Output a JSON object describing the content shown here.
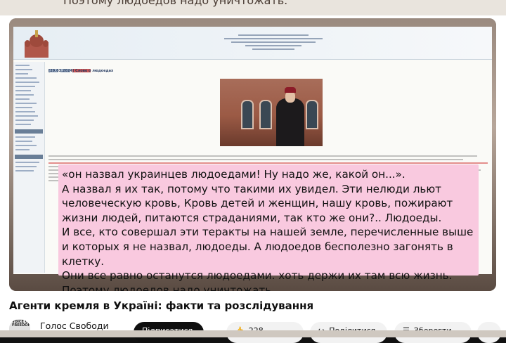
{
  "top_overlay": {
    "text": "Поэтому людоедов надо уничтожать."
  },
  "site": {
    "article_title": "[29.03.2024] Слово о людоедах"
  },
  "quote": {
    "text": "«он назвал украинцев людоедами! Ну надо же, какой он...».\nА назвал я их так, потому что такими их увидел. Эти нелюди льют\nчеловеческую кровь, Кровь детей и женщин, нашу кровь, пожирают\nжизни людей, питаются страданиями, так кто же они?.. Людоеды.\nИ все, кто совершал эти теракты на нашей земле, перечисленные выше\nи которых я не назвал, людоеды. А людоедов бесполезно загонять в клетку.\nОни все равно останутся людоедами. хоть держи их там всю жизнь.\nПоэтому людоедов надо уничтожать."
  },
  "video": {
    "title": "Агенти кремля в Україні: факти та розслідування"
  },
  "channel": {
    "avatar_text": "VOICE OF FREEDOM",
    "name": "Голос Свободи"
  },
  "actions": {
    "subscribe_label": "Підписатися",
    "like_count": "228",
    "share_label": "Поділитися",
    "save_label": "Зберегти",
    "more_label": "⋯"
  },
  "colors": {
    "quote_bg": "#f9c9df",
    "subscribe_bg": "#0f0f0f",
    "chip_bg": "#f2f2f2"
  }
}
